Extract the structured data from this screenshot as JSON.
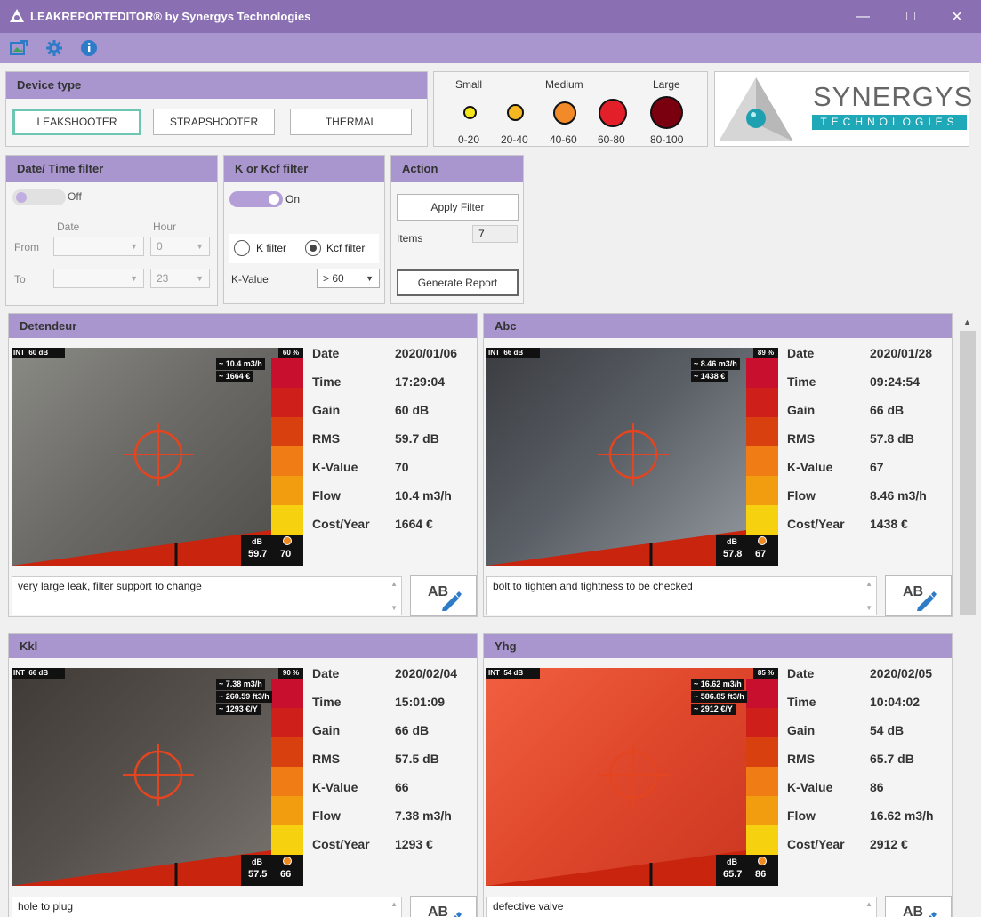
{
  "window": {
    "title": "LEAKREPORTEDITOR® by Synergys Technologies"
  },
  "toolbar": {
    "icons": [
      "image-export-icon",
      "gear-icon",
      "info-icon"
    ]
  },
  "device_type": {
    "header": "Device type",
    "buttons": [
      "LEAKSHOOTER",
      "STRAPSHOOTER",
      "THERMAL"
    ],
    "selected": "LEAKSHOOTER"
  },
  "legend": {
    "titles": {
      "small": "Small",
      "medium": "Medium",
      "large": "Large"
    },
    "ranges": [
      "0-20",
      "20-40",
      "40-60",
      "60-80",
      "80-100"
    ],
    "colors": [
      "#f5e61a",
      "#f5b820",
      "#f28a2a",
      "#e3202a",
      "#7a0010"
    ]
  },
  "logo": {
    "name": "SYNERGYS",
    "sub": "TECHNOLOGIES"
  },
  "date_filter": {
    "header": "Date/ Time filter",
    "toggle_label": "Off",
    "col_date": "Date",
    "col_hour": "Hour",
    "from_label": "From",
    "to_label": "To",
    "from_hour": "0",
    "to_hour": "23"
  },
  "k_filter": {
    "header": "K or Kcf filter",
    "toggle_label": "On",
    "option_k": "K filter",
    "option_kcf": "Kcf filter",
    "kvalue_label": "K-Value",
    "kvalue_selected": "> 60"
  },
  "action": {
    "header": "Action",
    "apply_label": "Apply Filter",
    "items_label": "Items",
    "items_count": "7",
    "report_label": "Generate Report"
  },
  "field_labels": [
    "Date",
    "Time",
    "Gain",
    "RMS",
    "K-Value",
    "Flow",
    "Cost/Year"
  ],
  "cards": [
    {
      "name": "Detendeur",
      "values": [
        "2020/01/06",
        "17:29:04",
        "60 dB",
        "59.7 dB",
        "70",
        "10.4 m3/h",
        "1664 €"
      ],
      "comment": "very large leak, filter support to change",
      "overlay": {
        "int": "INT",
        "gain": "60 dB",
        "pct": "60 %",
        "lines": [
          "~ 10.4 m3/h",
          "~ 1664 €"
        ],
        "db_label": "dB",
        "db": "59.7",
        "k": "70"
      },
      "bg": [
        "#6b6a66",
        "#4d4c48",
        "#8a8a85"
      ]
    },
    {
      "name": "Abc",
      "values": [
        "2020/01/28",
        "09:24:54",
        "66 dB",
        "57.8 dB",
        "67",
        "8.46 m3/h",
        "1438 €"
      ],
      "comment": "bolt to tighten and tightness to be checked",
      "overlay": {
        "int": "INT",
        "gain": "66 dB",
        "pct": "89 %",
        "lines": [
          "~ 8.46 m3/h",
          "~ 1438 €"
        ],
        "db_label": "dB",
        "db": "57.8",
        "k": "67"
      },
      "bg": [
        "#5a5f66",
        "#9aa0a6",
        "#3a3c40"
      ]
    },
    {
      "name": "Kkl",
      "values": [
        "2020/02/04",
        "15:01:09",
        "66 dB",
        "57.5 dB",
        "66",
        "7.38 m3/h",
        "1293 €"
      ],
      "comment": "hole to plug",
      "overlay": {
        "int": "INT",
        "gain": "66 dB",
        "pct": "90 %",
        "lines": [
          "~ 7.38 m3/h",
          "~ 260.59 ft3/h",
          "~ 1293 €/Y"
        ],
        "db_label": "dB",
        "db": "57.5",
        "k": "66"
      },
      "bg": [
        "#55504c",
        "#7d7772",
        "#3f3a36"
      ]
    },
    {
      "name": "Yhg",
      "values": [
        "2020/02/05",
        "10:04:02",
        "54 dB",
        "65.7 dB",
        "86",
        "16.62 m3/h",
        "2912 €"
      ],
      "comment": "defective valve",
      "overlay": {
        "int": "INT",
        "gain": "54 dB",
        "pct": "85 %",
        "lines": [
          "~ 16.62 m3/h",
          "~ 586.85 ft3/h",
          "~ 2912 €/Y"
        ],
        "db_label": "dB",
        "db": "65.7",
        "k": "86"
      },
      "bg": [
        "#e0482c",
        "#c93520",
        "#f06040"
      ]
    }
  ],
  "ab_label": "AB"
}
